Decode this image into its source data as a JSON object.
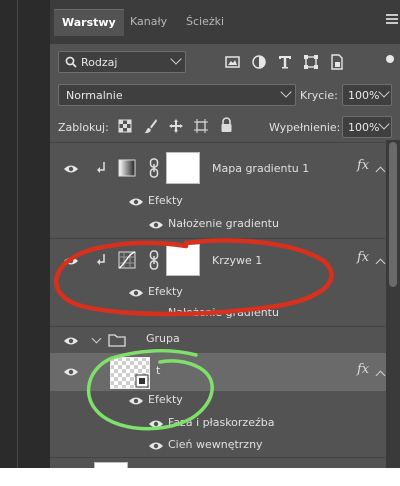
{
  "tabs": [
    {
      "label": "Warstwy",
      "active": true
    },
    {
      "label": "Kanały",
      "active": false
    },
    {
      "label": "Ścieżki",
      "active": false
    }
  ],
  "filter": {
    "selected": "Rodzaj"
  },
  "blend": {
    "mode": "Normalnie",
    "opacity_label": "Krycie:",
    "opacity": "100%"
  },
  "lock": {
    "label": "Zablokuj:",
    "fill_label": "Wypełnienie:",
    "fill": "100%"
  },
  "layers": {
    "mapa": {
      "name": "Mapa gradientu 1",
      "effects_label": "Efekty",
      "effect": "Nałożenie gradientu"
    },
    "krzywe": {
      "name": "Krzywe 1",
      "effects_label": "Efekty",
      "effect": "Nałożenie gradientu"
    },
    "group": {
      "name": "Grupa"
    },
    "t": {
      "name": "t",
      "effects_label": "Efekty",
      "effects": [
        "Faza i płaskorzeźba",
        "Cień wewnętrzny"
      ]
    }
  },
  "colors": {
    "panel_bg": "#535353",
    "tab_bg": "#3c3c3c",
    "selected_row": "#6a6a6a",
    "annotation_red": "#d9301e",
    "annotation_green": "#7fe06a"
  },
  "icons": [
    "search-icon",
    "image-filter-icon",
    "adjustment-filter-icon",
    "type-filter-icon",
    "shape-filter-icon",
    "smart-object-filter-icon",
    "eye-icon",
    "link-icon",
    "clip-arrow-icon",
    "gradient-map-icon",
    "curves-icon",
    "folder-icon",
    "fx-icon",
    "lock-icon",
    "brush-icon",
    "move-icon",
    "artboard-icon",
    "checker-lock-icon"
  ]
}
